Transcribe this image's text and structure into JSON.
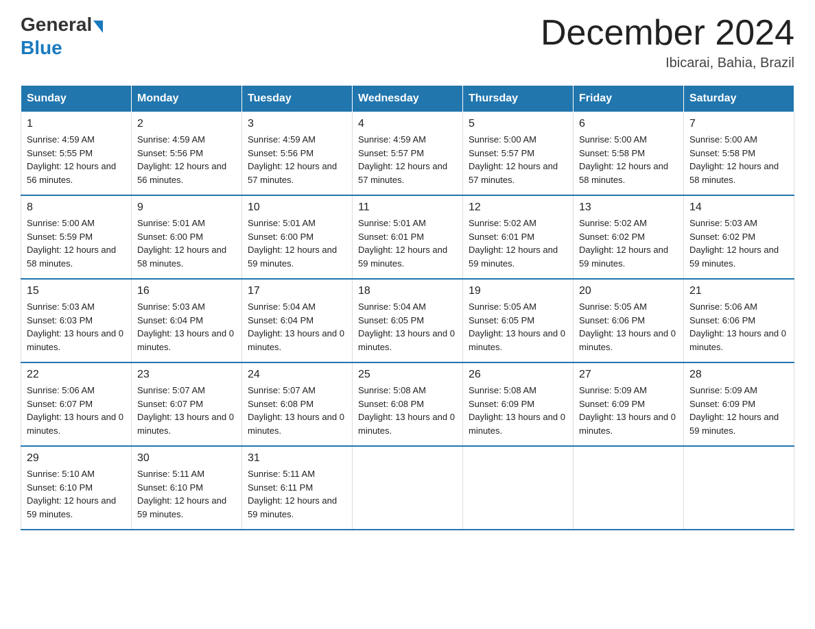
{
  "logo": {
    "general": "General",
    "blue": "Blue"
  },
  "title": "December 2024",
  "location": "Ibicarai, Bahia, Brazil",
  "headers": [
    "Sunday",
    "Monday",
    "Tuesday",
    "Wednesday",
    "Thursday",
    "Friday",
    "Saturday"
  ],
  "weeks": [
    [
      {
        "day": "1",
        "sunrise": "4:59 AM",
        "sunset": "5:55 PM",
        "daylight": "12 hours and 56 minutes."
      },
      {
        "day": "2",
        "sunrise": "4:59 AM",
        "sunset": "5:56 PM",
        "daylight": "12 hours and 56 minutes."
      },
      {
        "day": "3",
        "sunrise": "4:59 AM",
        "sunset": "5:56 PM",
        "daylight": "12 hours and 57 minutes."
      },
      {
        "day": "4",
        "sunrise": "4:59 AM",
        "sunset": "5:57 PM",
        "daylight": "12 hours and 57 minutes."
      },
      {
        "day": "5",
        "sunrise": "5:00 AM",
        "sunset": "5:57 PM",
        "daylight": "12 hours and 57 minutes."
      },
      {
        "day": "6",
        "sunrise": "5:00 AM",
        "sunset": "5:58 PM",
        "daylight": "12 hours and 58 minutes."
      },
      {
        "day": "7",
        "sunrise": "5:00 AM",
        "sunset": "5:58 PM",
        "daylight": "12 hours and 58 minutes."
      }
    ],
    [
      {
        "day": "8",
        "sunrise": "5:00 AM",
        "sunset": "5:59 PM",
        "daylight": "12 hours and 58 minutes."
      },
      {
        "day": "9",
        "sunrise": "5:01 AM",
        "sunset": "6:00 PM",
        "daylight": "12 hours and 58 minutes."
      },
      {
        "day": "10",
        "sunrise": "5:01 AM",
        "sunset": "6:00 PM",
        "daylight": "12 hours and 59 minutes."
      },
      {
        "day": "11",
        "sunrise": "5:01 AM",
        "sunset": "6:01 PM",
        "daylight": "12 hours and 59 minutes."
      },
      {
        "day": "12",
        "sunrise": "5:02 AM",
        "sunset": "6:01 PM",
        "daylight": "12 hours and 59 minutes."
      },
      {
        "day": "13",
        "sunrise": "5:02 AM",
        "sunset": "6:02 PM",
        "daylight": "12 hours and 59 minutes."
      },
      {
        "day": "14",
        "sunrise": "5:03 AM",
        "sunset": "6:02 PM",
        "daylight": "12 hours and 59 minutes."
      }
    ],
    [
      {
        "day": "15",
        "sunrise": "5:03 AM",
        "sunset": "6:03 PM",
        "daylight": "13 hours and 0 minutes."
      },
      {
        "day": "16",
        "sunrise": "5:03 AM",
        "sunset": "6:04 PM",
        "daylight": "13 hours and 0 minutes."
      },
      {
        "day": "17",
        "sunrise": "5:04 AM",
        "sunset": "6:04 PM",
        "daylight": "13 hours and 0 minutes."
      },
      {
        "day": "18",
        "sunrise": "5:04 AM",
        "sunset": "6:05 PM",
        "daylight": "13 hours and 0 minutes."
      },
      {
        "day": "19",
        "sunrise": "5:05 AM",
        "sunset": "6:05 PM",
        "daylight": "13 hours and 0 minutes."
      },
      {
        "day": "20",
        "sunrise": "5:05 AM",
        "sunset": "6:06 PM",
        "daylight": "13 hours and 0 minutes."
      },
      {
        "day": "21",
        "sunrise": "5:06 AM",
        "sunset": "6:06 PM",
        "daylight": "13 hours and 0 minutes."
      }
    ],
    [
      {
        "day": "22",
        "sunrise": "5:06 AM",
        "sunset": "6:07 PM",
        "daylight": "13 hours and 0 minutes."
      },
      {
        "day": "23",
        "sunrise": "5:07 AM",
        "sunset": "6:07 PM",
        "daylight": "13 hours and 0 minutes."
      },
      {
        "day": "24",
        "sunrise": "5:07 AM",
        "sunset": "6:08 PM",
        "daylight": "13 hours and 0 minutes."
      },
      {
        "day": "25",
        "sunrise": "5:08 AM",
        "sunset": "6:08 PM",
        "daylight": "13 hours and 0 minutes."
      },
      {
        "day": "26",
        "sunrise": "5:08 AM",
        "sunset": "6:09 PM",
        "daylight": "13 hours and 0 minutes."
      },
      {
        "day": "27",
        "sunrise": "5:09 AM",
        "sunset": "6:09 PM",
        "daylight": "13 hours and 0 minutes."
      },
      {
        "day": "28",
        "sunrise": "5:09 AM",
        "sunset": "6:09 PM",
        "daylight": "12 hours and 59 minutes."
      }
    ],
    [
      {
        "day": "29",
        "sunrise": "5:10 AM",
        "sunset": "6:10 PM",
        "daylight": "12 hours and 59 minutes."
      },
      {
        "day": "30",
        "sunrise": "5:11 AM",
        "sunset": "6:10 PM",
        "daylight": "12 hours and 59 minutes."
      },
      {
        "day": "31",
        "sunrise": "5:11 AM",
        "sunset": "6:11 PM",
        "daylight": "12 hours and 59 minutes."
      },
      null,
      null,
      null,
      null
    ]
  ]
}
